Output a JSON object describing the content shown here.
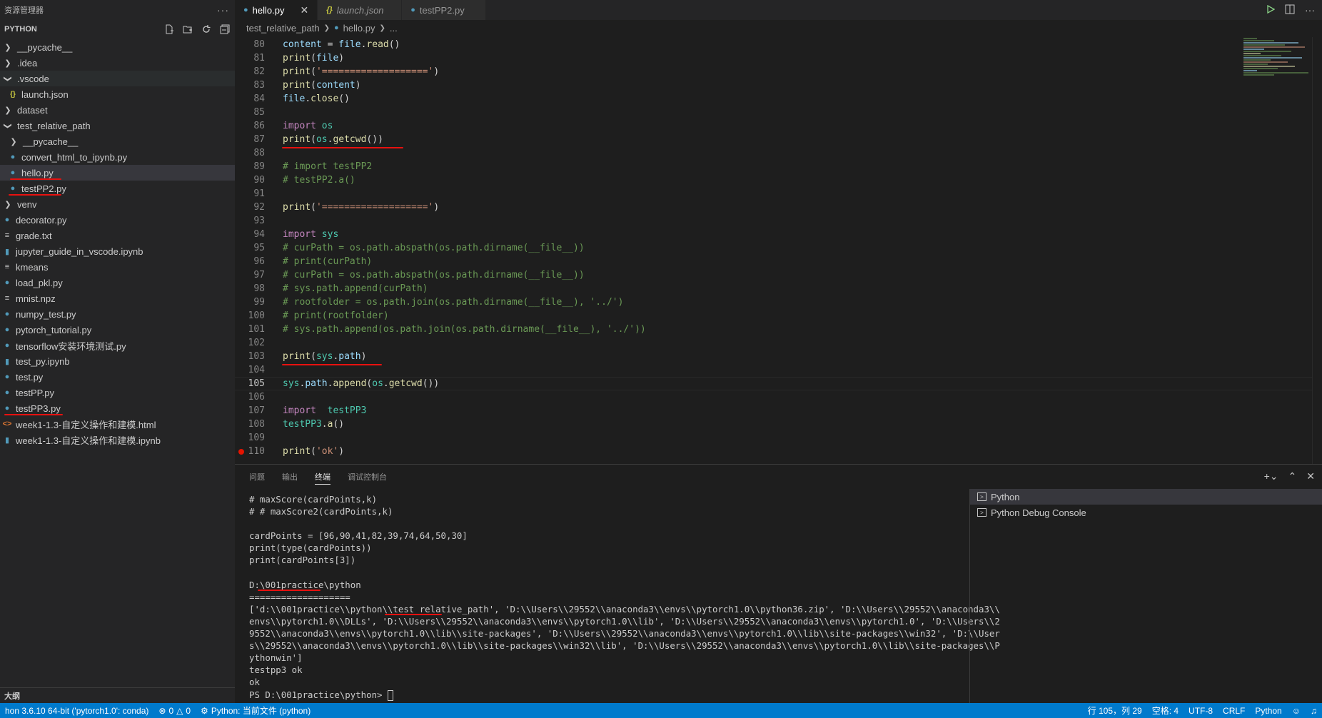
{
  "sidebar": {
    "title": "资源管理器",
    "more": "···",
    "section": "PYTHON",
    "outline": "大纲",
    "items": [
      {
        "label": "__pycache__",
        "type": "folder",
        "open": false,
        "depth": 0
      },
      {
        "label": ".idea",
        "type": "folder",
        "open": false,
        "depth": 0
      },
      {
        "label": ".vscode",
        "type": "folder",
        "open": true,
        "depth": 0
      },
      {
        "label": "launch.json",
        "type": "json",
        "depth": 1
      },
      {
        "label": "dataset",
        "type": "folder",
        "open": false,
        "depth": 0
      },
      {
        "label": "test_relative_path",
        "type": "folder",
        "open": true,
        "depth": 0
      },
      {
        "label": "__pycache__",
        "type": "folder",
        "open": false,
        "depth": 1
      },
      {
        "label": "convert_html_to_ipynb.py",
        "type": "py",
        "depth": 1
      },
      {
        "label": "hello.py",
        "type": "py",
        "depth": 1
      },
      {
        "label": "testPP2.py",
        "type": "py",
        "depth": 1
      },
      {
        "label": "venv",
        "type": "folder",
        "open": false,
        "depth": 0
      },
      {
        "label": "decorator.py",
        "type": "py",
        "depth": 0
      },
      {
        "label": "grade.txt",
        "type": "txt",
        "depth": 0
      },
      {
        "label": "jupyter_guide_in_vscode.ipynb",
        "type": "nb",
        "depth": 0
      },
      {
        "label": "kmeans",
        "type": "txt",
        "depth": 0
      },
      {
        "label": "load_pkl.py",
        "type": "py",
        "depth": 0
      },
      {
        "label": "mnist.npz",
        "type": "txt",
        "depth": 0
      },
      {
        "label": "numpy_test.py",
        "type": "py",
        "depth": 0
      },
      {
        "label": "pytorch_tutorial.py",
        "type": "py",
        "depth": 0
      },
      {
        "label": "tensorflow安装环境测试.py",
        "type": "py",
        "depth": 0
      },
      {
        "label": "test_py.ipynb",
        "type": "nb",
        "depth": 0
      },
      {
        "label": "test.py",
        "type": "py",
        "depth": 0
      },
      {
        "label": "testPP.py",
        "type": "py",
        "depth": 0
      },
      {
        "label": "testPP3.py",
        "type": "py",
        "depth": 0
      },
      {
        "label": "week1-1.3-自定义操作和建模.html",
        "type": "html",
        "depth": 0
      },
      {
        "label": "week1-1.3-自定义操作和建模.ipynb",
        "type": "nb",
        "depth": 0
      }
    ]
  },
  "editor": {
    "tabs": [
      {
        "label": "hello.py",
        "active": true,
        "icon": "python-icon"
      },
      {
        "label": "launch.json",
        "active": false,
        "icon": "json-icon"
      },
      {
        "label": "testPP2.py",
        "active": false,
        "icon": "python-icon"
      }
    ],
    "close": "✕",
    "breadcrumb": [
      "test_relative_path",
      "hello.py",
      "..."
    ]
  },
  "panel": {
    "tabs": [
      "问题",
      "输出",
      "终端",
      "调试控制台"
    ],
    "terminal_lines": [
      "# maxScore(cardPoints,k)",
      "# # maxScore2(cardPoints,k)",
      "",
      "cardPoints = [96,90,41,82,39,74,64,50,30]",
      "print(type(cardPoints))",
      "print(cardPoints[3])",
      "",
      "D:\\001practice\\python",
      "===================",
      "['d:\\\\001practice\\\\python\\\\test_relative_path', 'D:\\\\Users\\\\29552\\\\anaconda3\\\\envs\\\\pytorch1.0\\\\python36.zip', 'D:\\\\Users\\\\29552\\\\anaconda3\\\\",
      "envs\\\\pytorch1.0\\\\DLLs', 'D:\\\\Users\\\\29552\\\\anaconda3\\\\envs\\\\pytorch1.0\\\\lib', 'D:\\\\Users\\\\29552\\\\anaconda3\\\\envs\\\\pytorch1.0', 'D:\\\\Users\\\\2",
      "9552\\\\anaconda3\\\\envs\\\\pytorch1.0\\\\lib\\\\site-packages', 'D:\\\\Users\\\\29552\\\\anaconda3\\\\envs\\\\pytorch1.0\\\\lib\\\\site-packages\\\\win32', 'D:\\\\User",
      "s\\\\29552\\\\anaconda3\\\\envs\\\\pytorch1.0\\\\lib\\\\site-packages\\\\win32\\\\lib', 'D:\\\\Users\\\\29552\\\\anaconda3\\\\envs\\\\pytorch1.0\\\\lib\\\\site-packages\\\\P",
      "ythonwin']",
      "testpp3 ok",
      "ok"
    ],
    "prompt": "PS D:\\001practice\\python> ",
    "terminals": [
      "Python",
      "Python Debug Console"
    ]
  },
  "status": {
    "interpreter": "hon 3.6.10 64-bit ('pytorch1.0': conda)",
    "errors": "0",
    "warnings": "0",
    "run_config": "Python: 当前文件 (python)",
    "position": "行 105，列 29",
    "spaces": "空格: 4",
    "encoding": "UTF-8",
    "eol": "CRLF",
    "language": "Python"
  }
}
